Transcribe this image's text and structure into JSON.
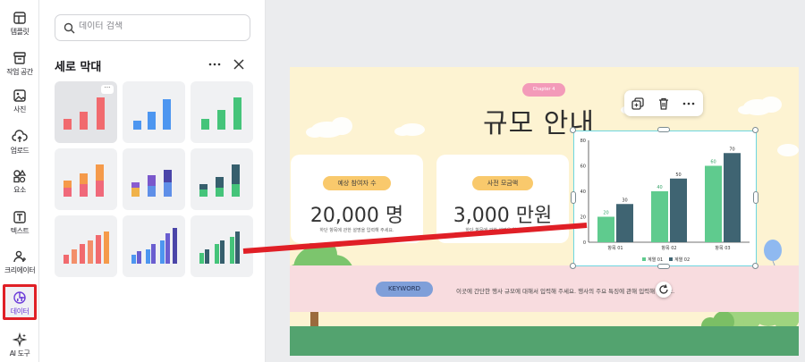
{
  "rail": {
    "items": [
      {
        "label": "템플릿"
      },
      {
        "label": "작업 공간"
      },
      {
        "label": "사진"
      },
      {
        "label": "업로드"
      },
      {
        "label": "요소"
      },
      {
        "label": "텍스트"
      },
      {
        "label": "크리에이터"
      },
      {
        "label": "데이터"
      },
      {
        "label": "AI 도구"
      }
    ]
  },
  "panel": {
    "search_placeholder": "데이터 검색",
    "title": "세로 막대",
    "more_label": "···",
    "tile_dots": "···"
  },
  "canvas": {
    "chapter": "Chapter 4",
    "title": "규모 안내",
    "cards": [
      {
        "pill": "예상 참여자 수",
        "big": "20,000 명",
        "small": "하단 항목에 관한 설명을 입력해 주세요."
      },
      {
        "pill": "사전 모금액",
        "big": "3,000 만원",
        "small": "하단 항목에 관한 설명을 입력해 주세요."
      }
    ],
    "keyword": "KEYWORD",
    "keyword_text": "이곳에 간단한 행사 규모에 대해서 입력해 주세요. 행사의 주요 특징에 관해 입력해 주세요."
  },
  "colors": {
    "accent_red": "#e01f26",
    "series1": "#5fcb8e",
    "series2": "#3f6472"
  },
  "chart_data": {
    "type": "bar",
    "categories": [
      "항목 01",
      "항목 02",
      "항목 03"
    ],
    "series": [
      {
        "name": "계열 01",
        "values": [
          20,
          40,
          60
        ]
      },
      {
        "name": "계열 02",
        "values": [
          30,
          50,
          70
        ]
      }
    ],
    "yticks": [
      "0",
      "20",
      "40",
      "60",
      "80"
    ],
    "ylim": [
      0,
      80
    ],
    "legend": "bottom"
  }
}
